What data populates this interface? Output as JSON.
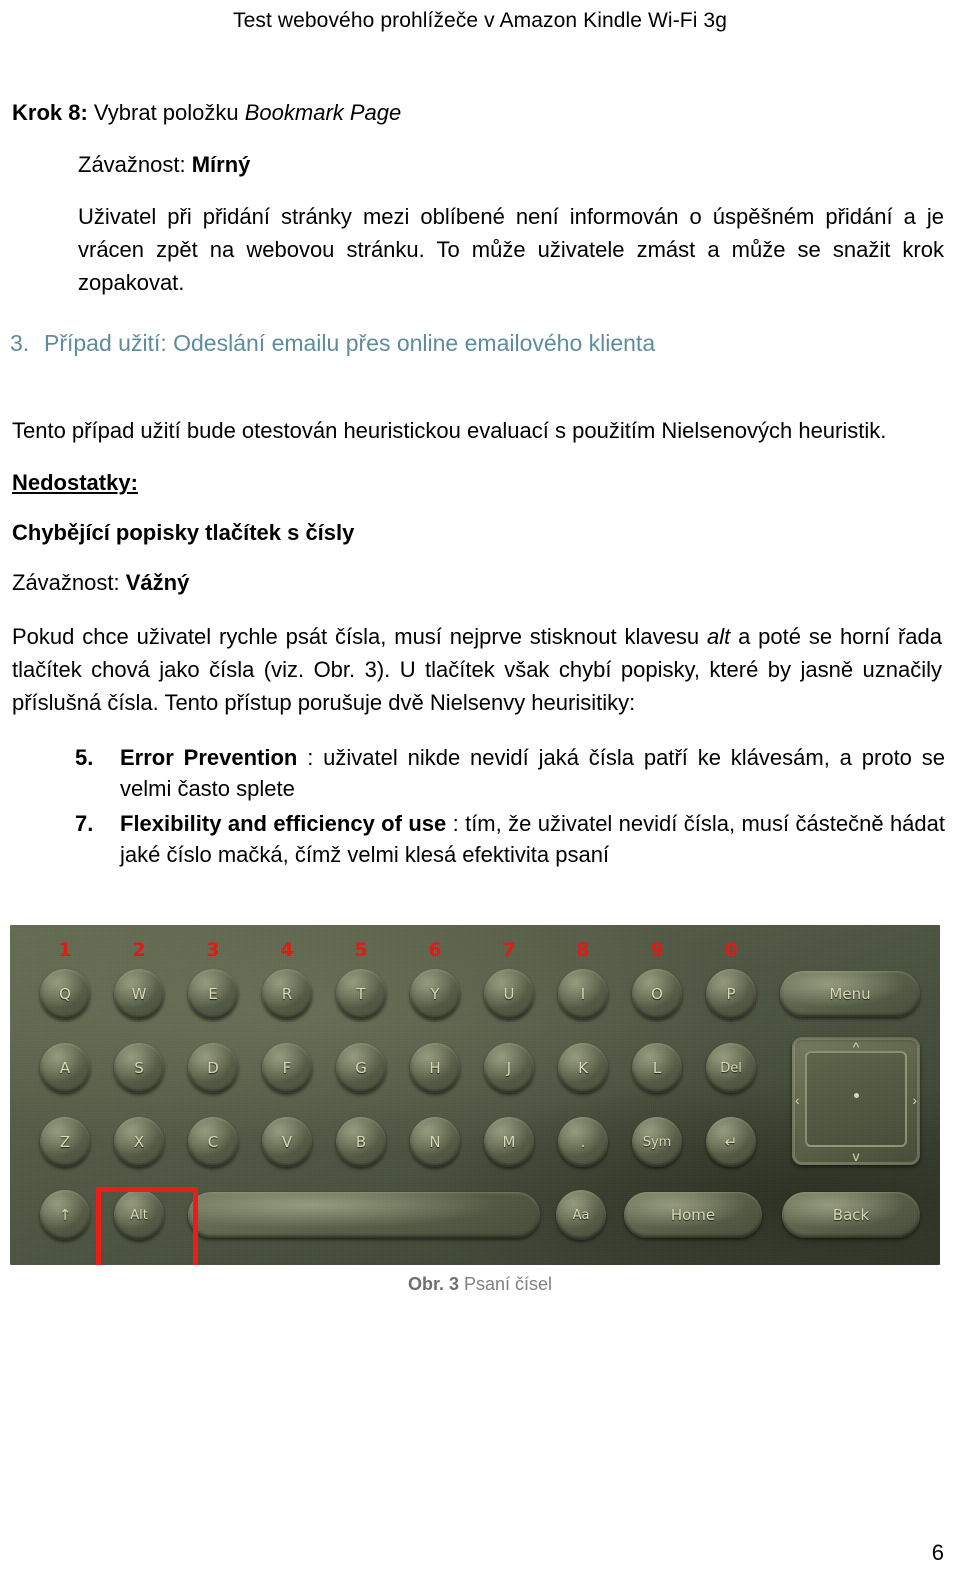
{
  "document": {
    "running_header": "Test webového prohlížeče v Amazon Kindle Wi-Fi 3g",
    "page_number": "6"
  },
  "step": {
    "label": "Krok 8:",
    "text_before": " Vybrat položku ",
    "italic_item": "Bookmark Page"
  },
  "severity_1": {
    "label": "Závažnost:",
    "value": "Mírný"
  },
  "paragraph_bookmark": "Uživatel při přidání stránky mezi oblíbené není informován o úspěšném přidání a je vrácen zpět na webovou stránku. To může uživatele zmást a může se snažit krok zopakovat.",
  "section_heading": {
    "number": "3.",
    "title": "Případ užití: Odeslání emailu přes online emailového klienta",
    "color": "#5d8c9c"
  },
  "paragraph_nielsen": "Tento případ užití bude otestován heuristickou evaluací s použitím Nielsenových heuristik.",
  "subhead_deficiencies": "Nedostatky:",
  "subhead_issue": "Chybějící popisky tlačítek s čísly",
  "severity_2": {
    "label": "Závažnost:",
    "value": "Vážný"
  },
  "paragraph_alt": {
    "part_1": "Pokud chce uživatel rychle psát čísla, musí nejprve stisknout klavesu ",
    "italic": "alt",
    "part_2": " a poté se horní řada tlačítek chová jako čísla (viz. Obr. 3). U tlačítek však chybí popisky, které by jasně uznačily příslušná čísla. Tento přístup porušuje dvě Nielsenvy heurisitiky:"
  },
  "heuristics": [
    {
      "number": "5.",
      "title": "Error Prevention",
      "text": " : uživatel nikde nevidí jaká čísla patří ke klávesám, a proto se velmi často splete"
    },
    {
      "number": "7.",
      "title": "Flexibility and efficiency of use",
      "text": " : tím, že uživatel nevidí čísla, musí částečně hádat jaké číslo mačká, čímž velmi klesá  efektivita psaní"
    }
  ],
  "figure": {
    "caption_bold": "Obr. 3",
    "caption_text": " Psaní čísel",
    "annotation_color": "#e01a14",
    "highlight_color": "#ee1b16",
    "number_annotations": [
      "1",
      "2",
      "3",
      "4",
      "5",
      "6",
      "7",
      "8",
      "9",
      "0"
    ],
    "keyboard_rows": {
      "row_1": [
        "Q",
        "W",
        "E",
        "R",
        "T",
        "Y",
        "U",
        "I",
        "O",
        "P"
      ],
      "row_1_special": "Menu",
      "row_2": [
        "A",
        "S",
        "D",
        "F",
        "G",
        "H",
        "J",
        "K",
        "L"
      ],
      "row_2_special": "Del",
      "row_3": [
        "Z",
        "X",
        "C",
        "V",
        "B",
        "N",
        "M",
        ".",
        "Sym"
      ],
      "row_3_enter": "↵",
      "row_4_shift": "↑",
      "row_4_alt": "Alt",
      "row_4_space": "",
      "row_4_font": "Aa",
      "row_4_home": "Home",
      "row_4_back": "Back"
    },
    "dpad_arrows": {
      "up": "^",
      "down": "v",
      "left": "‹",
      "right": "›"
    },
    "highlighted_key": "Alt"
  }
}
